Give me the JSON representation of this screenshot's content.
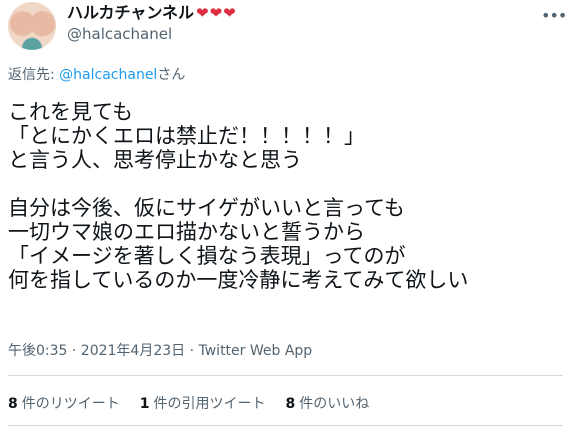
{
  "author": {
    "display_name": "ハルカチャンネル",
    "hearts": "❤❤❤",
    "handle": "@halcachanel"
  },
  "reply_to": {
    "prefix": "返信先: ",
    "mention": "@halcachanel",
    "suffix": "さん"
  },
  "tweet": {
    "text": "これを見ても\n「とにかくエロは禁止だ！！！！！」\nと言う人、思考停止かなと思う\n\n自分は今後、仮にサイゲがいいと言っても\n一切ウマ娘のエロ描かないと誓うから\n「イメージを著しく損なう表現」ってのが\n何を指しているのか一度冷静に考えてみて欲しい"
  },
  "meta": "午後0:35 · 2021年4月23日 · Twitter Web App",
  "stats": [
    {
      "count": "8",
      "label": "件のリツイート"
    },
    {
      "count": "1",
      "label": "件の引用ツイート"
    },
    {
      "count": "8",
      "label": "件のいいね"
    }
  ],
  "icons": {
    "more": "more-dots-icon",
    "heart": "heart-icon"
  },
  "colors": {
    "mention": "#1d9bf0",
    "secondary_text": "#536471",
    "heart": "#dd2e44"
  }
}
